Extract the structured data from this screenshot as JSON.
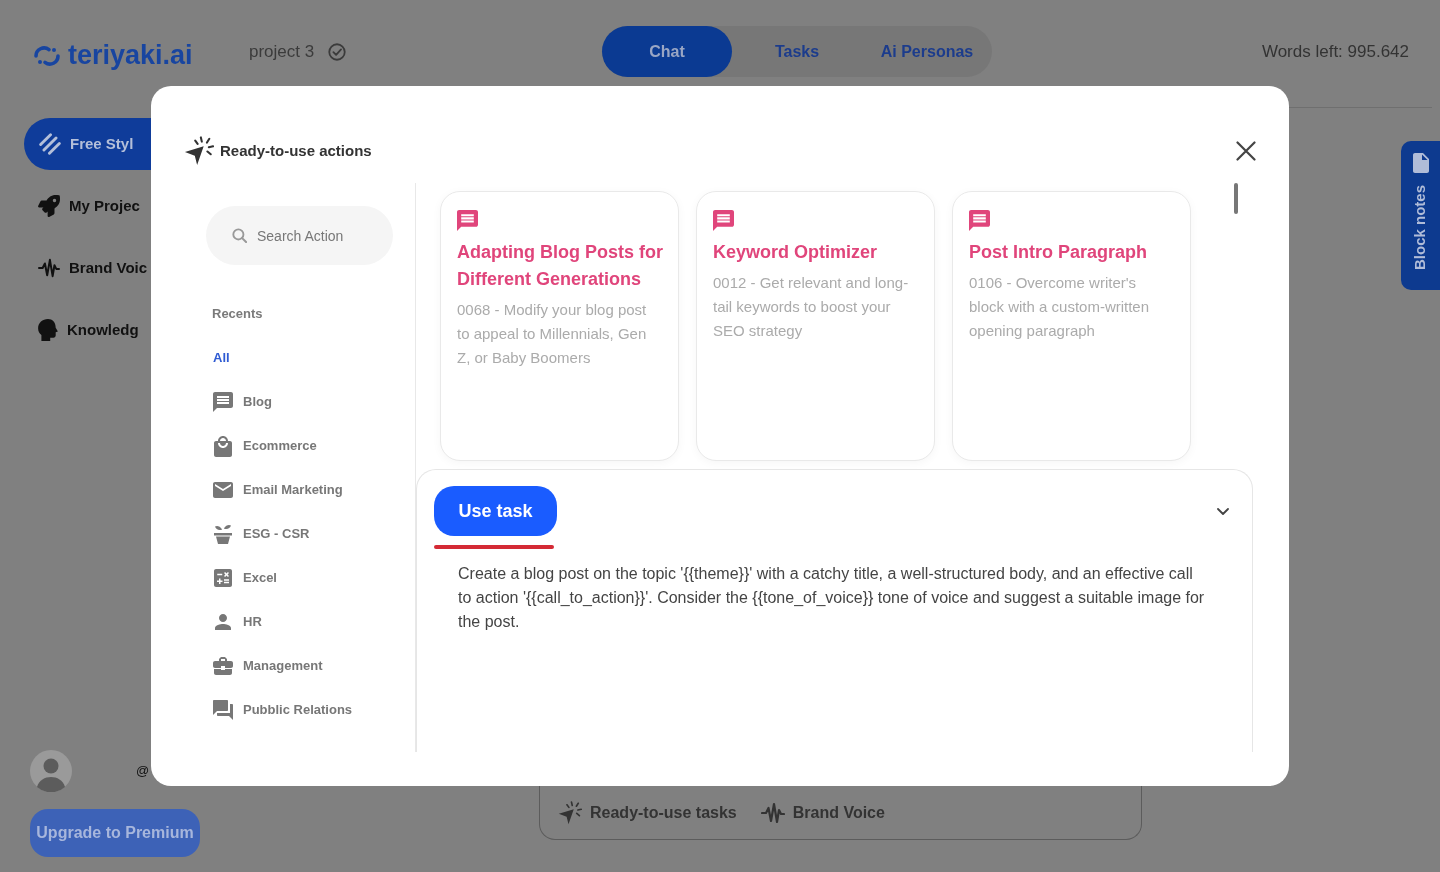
{
  "header": {
    "logo": "teriyaki.ai",
    "project": "project 3",
    "tabs": [
      {
        "label": "Chat",
        "selected": true
      },
      {
        "label": "Tasks",
        "selected": false
      },
      {
        "label": "Ai Personas",
        "selected": false
      }
    ],
    "words_left": "Words left: 995.642"
  },
  "sidebar": {
    "items": [
      {
        "kind": "free_style",
        "label": "Free Styl",
        "selected": true
      },
      {
        "kind": "projects",
        "label": "My Projec",
        "selected": false
      },
      {
        "kind": "brand_voice",
        "label": "Brand Voic",
        "selected": false
      },
      {
        "kind": "knowledge",
        "label": "Knowledg",
        "selected": false
      }
    ],
    "user_handle": "@",
    "upgrade_button": "Upgrade to Premium"
  },
  "block_notes": {
    "label": "Block notes"
  },
  "composer": {
    "shortcuts": [
      {
        "kind": "tasks",
        "label": "Ready-to-use tasks"
      },
      {
        "kind": "brand_voice",
        "label": "Brand Voice"
      }
    ]
  },
  "dialog": {
    "title": "Ready-to-use actions",
    "search": {
      "placeholder": "Search Action"
    },
    "recents": "Recents",
    "categories": [
      {
        "kind": "all",
        "label": "All",
        "selected": true
      },
      {
        "kind": "blog",
        "label": "Blog",
        "selected": false
      },
      {
        "kind": "ecommerce",
        "label": "Ecommerce",
        "selected": false
      },
      {
        "kind": "email",
        "label": "Email Marketing",
        "selected": false
      },
      {
        "kind": "esg",
        "label": "ESG - CSR",
        "selected": false
      },
      {
        "kind": "excel",
        "label": "Excel",
        "selected": false
      },
      {
        "kind": "hr",
        "label": "HR",
        "selected": false
      },
      {
        "kind": "management",
        "label": "Management",
        "selected": false
      },
      {
        "kind": "pr",
        "label": "Pubblic Relations",
        "selected": false
      }
    ],
    "cards": [
      {
        "title": "Adapting Blog Posts for Different Generations",
        "description": "0068 - Modify your blog post to appeal to Millennials, Gen Z, or Baby Boomers"
      },
      {
        "title": "Keyword Optimizer",
        "description": "0012 - Get relevant and long-tail keywords to boost your SEO strategy"
      },
      {
        "title": "Post Intro Paragraph",
        "description": "0106 - Overcome writer's block with a custom-written opening paragraph"
      }
    ],
    "task": {
      "button": "Use task",
      "prompt": "Create a blog post on the topic '{{theme}}' with a catchy title, a well-structured body, and an effective call to action '{{call_to_action}}'. Consider the {{tone_of_voice}} tone of voice and suggest a suitable image for the post."
    }
  }
}
